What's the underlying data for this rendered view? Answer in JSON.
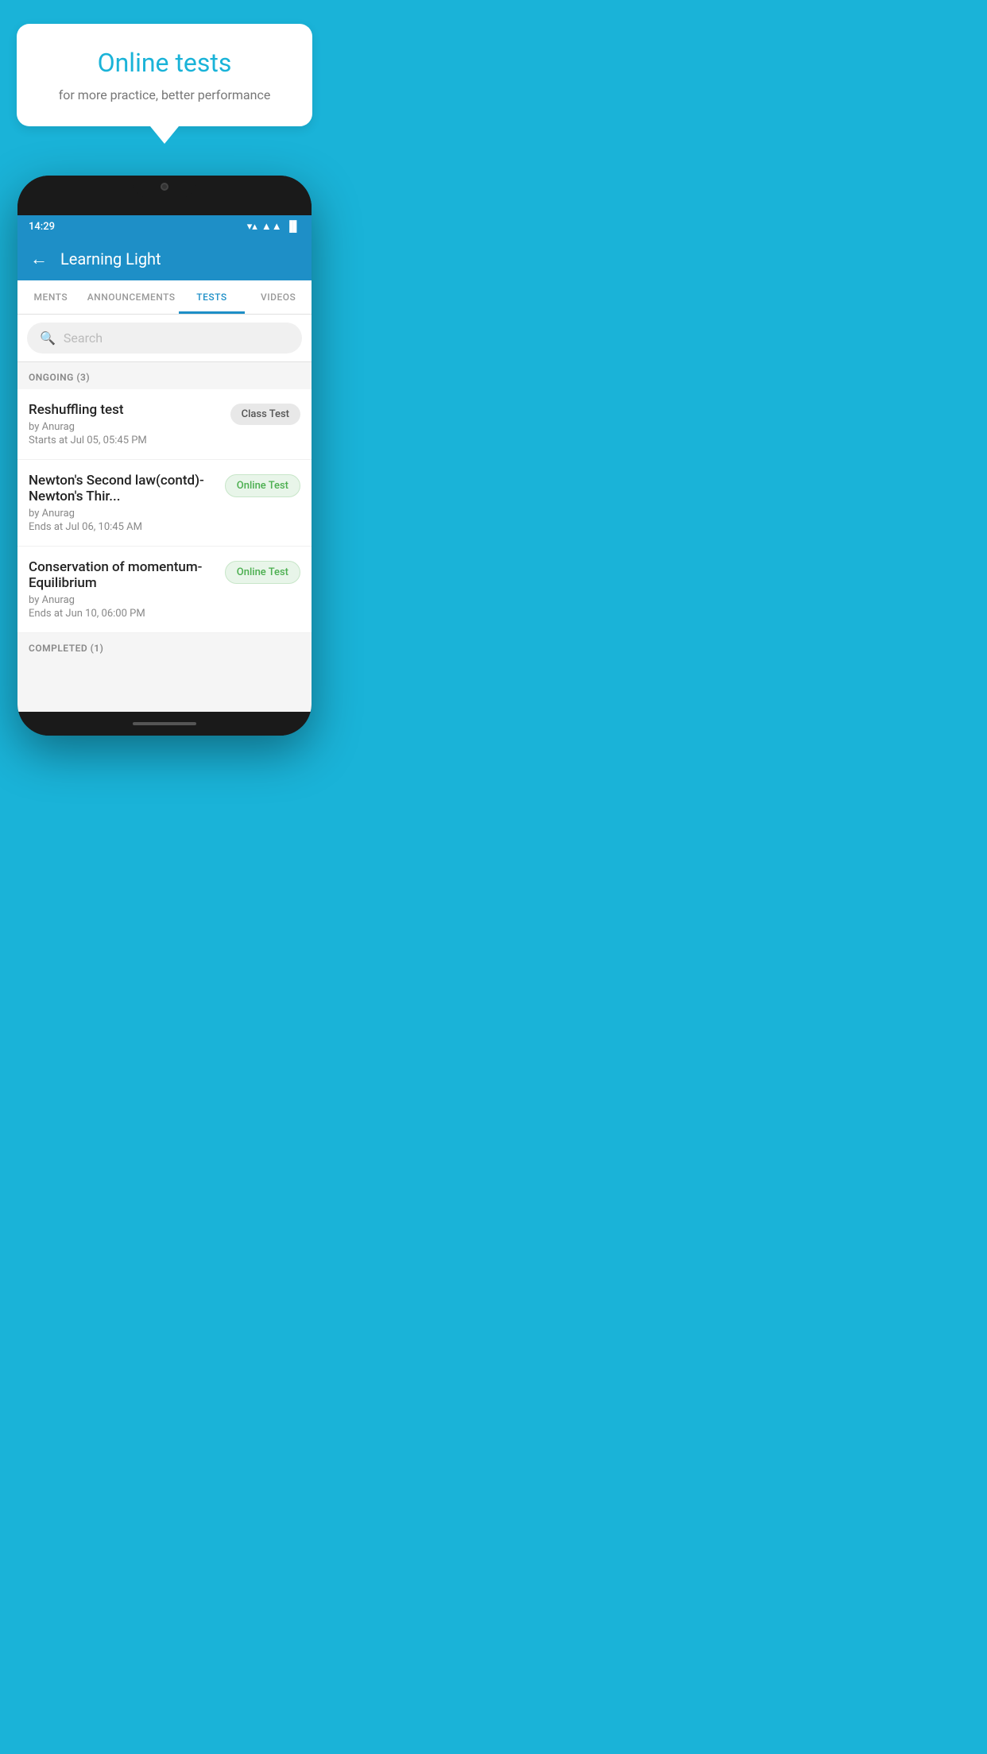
{
  "bubble": {
    "title": "Online tests",
    "subtitle": "for more practice, better performance"
  },
  "status_bar": {
    "time": "14:29",
    "wifi": "▼",
    "signal": "▲",
    "battery": "▐"
  },
  "header": {
    "title": "Learning Light",
    "back_label": "←"
  },
  "tabs": [
    {
      "label": "MENTS",
      "active": false
    },
    {
      "label": "ANNOUNCEMENTS",
      "active": false
    },
    {
      "label": "TESTS",
      "active": true
    },
    {
      "label": "VIDEOS",
      "active": false
    }
  ],
  "search": {
    "placeholder": "Search"
  },
  "ongoing_section": {
    "label": "ONGOING (3)"
  },
  "ongoing_tests": [
    {
      "name": "Reshuffling test",
      "author": "by Anurag",
      "time_label": "Starts at",
      "time": "Jul 05, 05:45 PM",
      "badge": "Class Test",
      "badge_type": "class"
    },
    {
      "name": "Newton's Second law(contd)-Newton's Thir...",
      "author": "by Anurag",
      "time_label": "Ends at",
      "time": "Jul 06, 10:45 AM",
      "badge": "Online Test",
      "badge_type": "online"
    },
    {
      "name": "Conservation of momentum-Equilibrium",
      "author": "by Anurag",
      "time_label": "Ends at",
      "time": "Jun 10, 06:00 PM",
      "badge": "Online Test",
      "badge_type": "online"
    }
  ],
  "completed_section": {
    "label": "COMPLETED (1)"
  }
}
